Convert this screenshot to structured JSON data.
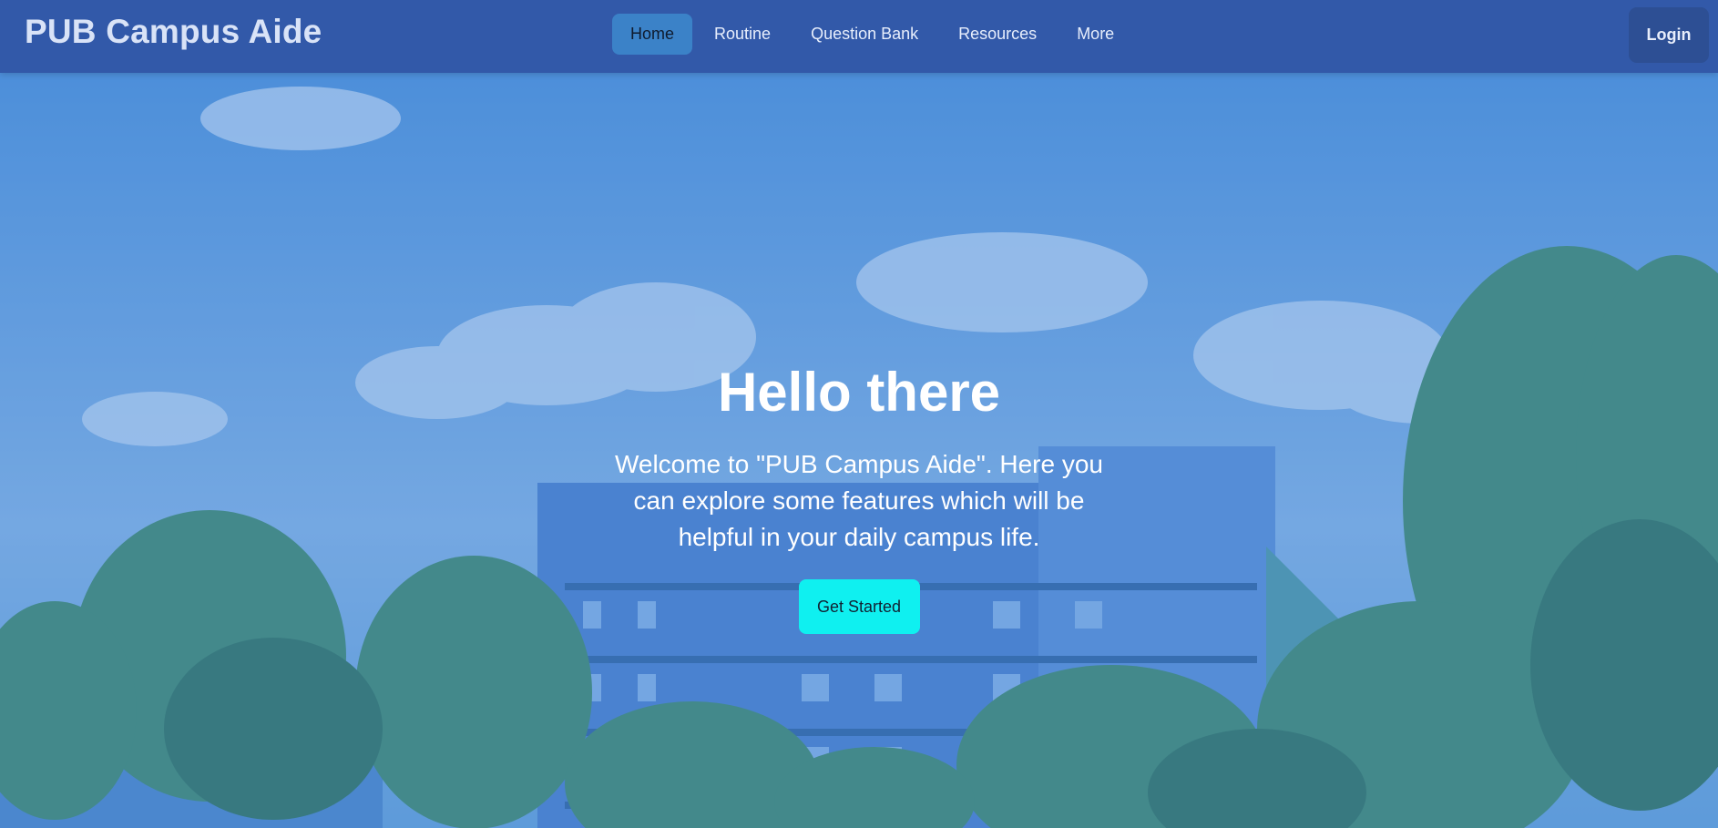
{
  "navbar": {
    "brand": "PUB Campus Aide",
    "items": [
      {
        "label": "Home",
        "active": true
      },
      {
        "label": "Routine",
        "active": false
      },
      {
        "label": "Question Bank",
        "active": false
      },
      {
        "label": "Resources",
        "active": false
      },
      {
        "label": "More",
        "active": false
      }
    ],
    "login_label": "Login"
  },
  "hero": {
    "title": "Hello there",
    "text": "Welcome to \"PUB Campus Aide\". Here you can explore some features which will be helpful in your daily campus life.",
    "cta_label": "Get Started"
  },
  "colors": {
    "navbar_bg": "#3259a9",
    "active_item_bg": "#3b82c8",
    "cta_bg": "#0ff0f0",
    "login_bg": "#2d4f94"
  }
}
